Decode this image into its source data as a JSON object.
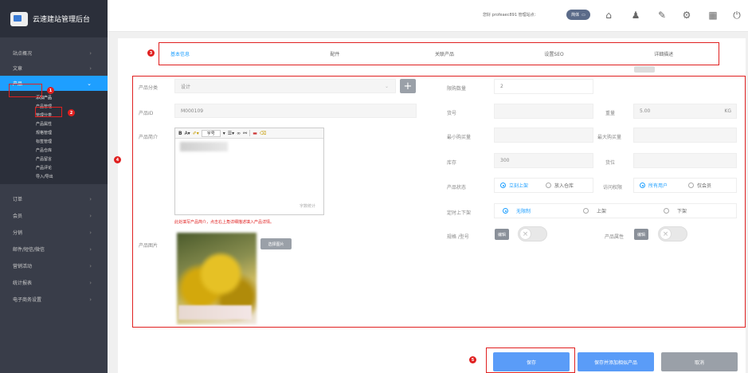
{
  "app": {
    "title": "云速建站管理后台"
  },
  "sidebar": {
    "items": [
      {
        "label": "站点概况"
      },
      {
        "label": "文章"
      },
      {
        "label": "产品"
      }
    ],
    "product_subitems": [
      "添加产品",
      "产品管理",
      "管理分类",
      "产品属性",
      "规格管理",
      "标签管理",
      "产品仓库",
      "产品留言",
      "产品评论",
      "导入/导出"
    ],
    "items_after": [
      {
        "label": "订单"
      },
      {
        "label": "会员"
      },
      {
        "label": "分销"
      },
      {
        "label": "邮件/短信/微信"
      },
      {
        "label": "营销活动"
      },
      {
        "label": "统计报表"
      },
      {
        "label": "电子商务设置"
      }
    ]
  },
  "topbar": {
    "user_text": "您好 profeaec891  管理站点：",
    "system_pill": "简体",
    "icons": [
      "home-icon",
      "user-icon",
      "share-icon",
      "gear-icon",
      "grid-icon",
      "power-icon"
    ]
  },
  "tabs": [
    "基本信息",
    "配件",
    "关联产品",
    "设置SEO",
    "详细描述"
  ],
  "form": {
    "category": {
      "label": "产品分类",
      "value": "设计"
    },
    "product_id": {
      "label": "产品ID",
      "value": "M000109"
    },
    "intro": {
      "label": "产品简介",
      "font_label": "字号",
      "char_count": "字数统计",
      "hint": "此处填写产品简介，点击右上角详细描述填入产品详情。"
    },
    "image": {
      "label": "产品图片",
      "choose_button": "选择图片"
    },
    "limit_qty": {
      "label": "限购数量",
      "value": "2"
    },
    "sku": {
      "label": "货号",
      "value": ""
    },
    "weight": {
      "label": "重量",
      "value": "5.00",
      "unit": "KG"
    },
    "min_qty": {
      "label": "最小购买量",
      "value": ""
    },
    "max_qty": {
      "label": "最大购买量",
      "value": ""
    },
    "stock": {
      "label": "库存",
      "value": "300"
    },
    "location": {
      "label": "货位",
      "value": ""
    },
    "status": {
      "label": "产品状态",
      "options": [
        "立刻上架",
        "放入仓库"
      ],
      "selected": 0
    },
    "access": {
      "label": "访问权限",
      "options": [
        "所有用户",
        "仅会员"
      ],
      "selected": 0
    },
    "schedule": {
      "label": "定时上下架",
      "options": [
        "无限制",
        "上架",
        "下架"
      ],
      "selected": 0
    },
    "spec": {
      "label": "规格 /型号",
      "edit": "编辑"
    },
    "attrs": {
      "label": "产品属性",
      "edit": "编辑"
    }
  },
  "actions": {
    "save": "保存",
    "save_add": "保存并添加相似产品",
    "cancel": "取消"
  },
  "annotations": [
    "1",
    "2",
    "3",
    "4",
    "5"
  ],
  "colors": {
    "accent": "#1e9fff",
    "sidebar": "#393d49",
    "annotation": "#e02020"
  }
}
